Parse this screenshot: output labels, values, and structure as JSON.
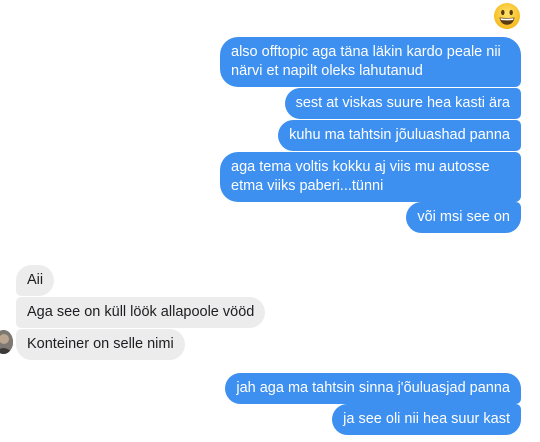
{
  "conversation": {
    "reaction_emoji": "grinning-face",
    "colors": {
      "outgoing_bubble": "#3d8ff0",
      "incoming_bubble": "#ececec",
      "outgoing_text": "#ffffff",
      "incoming_text": "#1c1e21"
    },
    "messages": [
      {
        "sender": "me",
        "text": "also offtopic aga täna läkin kardo peale nii närvi et napilt oleks lahutanud"
      },
      {
        "sender": "me",
        "text": "sest at viskas suure hea kasti ära"
      },
      {
        "sender": "me",
        "text": "kuhu ma tahtsin jõuluashad panna"
      },
      {
        "sender": "me",
        "text": "aga tema voltis kokku aj viis mu autosse etma viiks paberi...tünni"
      },
      {
        "sender": "me",
        "text": "või msi see on"
      },
      {
        "sender": "other",
        "text": "Aii"
      },
      {
        "sender": "other",
        "text": "Aga see on küll löök allapoole vööd"
      },
      {
        "sender": "other",
        "text": "Konteiner on selle nimi"
      },
      {
        "sender": "me",
        "text": "jah aga ma tahtsin sinna j'õuluasjad panna"
      },
      {
        "sender": "me",
        "text": "ja see oli nii hea suur kast"
      }
    ]
  }
}
